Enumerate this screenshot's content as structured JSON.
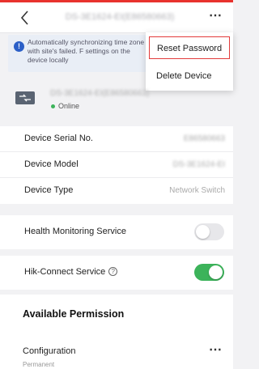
{
  "header": {
    "title": "DS-3E1624-EI(E86580663)",
    "more_glyph": "⋯"
  },
  "banner": {
    "icon": "info-icon",
    "text": "Automatically synchronizing time zone with site's failed. F settings on the device locally"
  },
  "menu": {
    "items": [
      "Reset Password",
      "Delete Device"
    ]
  },
  "device": {
    "name": "DS-3E1624-EI(E86580663)",
    "status": "Online"
  },
  "info_rows": [
    {
      "label": "Device Serial No.",
      "value": "E86580663"
    },
    {
      "label": "Device Model",
      "value": "DS-3E1624-EI"
    },
    {
      "label": "Device Type",
      "value": "Network Switch"
    }
  ],
  "services": {
    "health_label": "Health Monitoring Service",
    "health_on": false,
    "hik_label": "Hik-Connect Service",
    "hik_help": "?",
    "hik_on": true
  },
  "permission": {
    "heading": "Available Permission",
    "item_title": "Configuration",
    "item_sub": "Permanent",
    "more_glyph": "⋯"
  },
  "colors": {
    "accent_red": "#e8322d",
    "toggle_on": "#3cb35a",
    "info_blue": "#2b5fc7"
  }
}
